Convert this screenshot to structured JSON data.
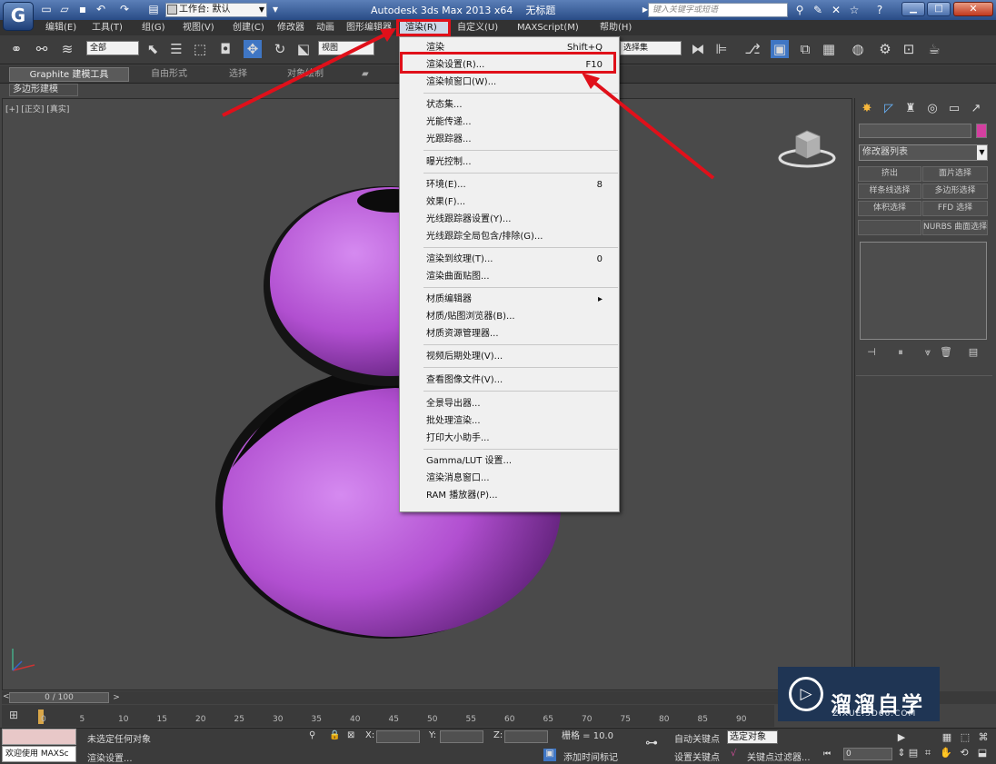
{
  "titlebar": {
    "app_icon": "3ds-max-logo",
    "workspace_label": "工作台: 默认",
    "app_title": "Autodesk 3ds Max  2013 x64",
    "doc_title": "无标题",
    "search_placeholder": "键入关键字或短语"
  },
  "menubar": {
    "items": [
      "编辑(E)",
      "工具(T)",
      "组(G)",
      "视图(V)",
      "创建(C)",
      "修改器",
      "动画",
      "图形编辑器",
      "渲染(R)",
      "自定义(U)",
      "MAXScript(M)",
      "帮助(H)"
    ],
    "active_index": 8
  },
  "toolbar": {
    "selection_filter": "全部",
    "ref_coord": "视图",
    "named_sel": "选择集"
  },
  "ribbon": {
    "tabs": [
      "Graphite 建模工具",
      "自由形式",
      "选择",
      "对象绘制"
    ],
    "sub_label": "多边形建模"
  },
  "viewport": {
    "label": "[+] [正交] [真实]",
    "object_color": "#b14fd0"
  },
  "render_menu": {
    "items": [
      {
        "label": "渲染",
        "shortcut": "Shift+Q"
      },
      {
        "label": "渲染设置(R)...",
        "shortcut": "F10"
      },
      {
        "label": "渲染帧窗口(W)...",
        "shortcut": ""
      },
      {
        "label": "状态集...",
        "shortcut": ""
      },
      {
        "label": "光能传递...",
        "shortcut": ""
      },
      {
        "label": "光跟踪器...",
        "shortcut": ""
      },
      {
        "label": "曝光控制...",
        "shortcut": ""
      },
      {
        "label": "环境(E)...",
        "shortcut": "8"
      },
      {
        "label": "效果(F)...",
        "shortcut": ""
      },
      {
        "label": "光线跟踪器设置(Y)...",
        "shortcut": ""
      },
      {
        "label": "光线跟踪全局包含/排除(G)...",
        "shortcut": ""
      },
      {
        "label": "渲染到纹理(T)...",
        "shortcut": "0"
      },
      {
        "label": "渲染曲面贴图...",
        "shortcut": ""
      },
      {
        "label": "材质编辑器",
        "shortcut": "▸"
      },
      {
        "label": "材质/贴图浏览器(B)...",
        "shortcut": ""
      },
      {
        "label": "材质资源管理器...",
        "shortcut": ""
      },
      {
        "label": "视频后期处理(V)...",
        "shortcut": ""
      },
      {
        "label": "查看图像文件(V)...",
        "shortcut": ""
      },
      {
        "label": "全景导出器...",
        "shortcut": ""
      },
      {
        "label": "批处理渲染...",
        "shortcut": ""
      },
      {
        "label": "打印大小助手...",
        "shortcut": ""
      },
      {
        "label": "Gamma/LUT 设置...",
        "shortcut": ""
      },
      {
        "label": "渲染消息窗口...",
        "shortcut": ""
      },
      {
        "label": "RAM 播放器(P)...",
        "shortcut": ""
      }
    ],
    "highlighted_index": 1
  },
  "command_panel": {
    "modifier_list": "修改器列表",
    "name_color": "#d43fa0",
    "buttons": [
      "挤出",
      "面片选择",
      "样条线选择",
      "多边形选择",
      "体积选择",
      "FFD 选择",
      "",
      "NURBS 曲面选择"
    ]
  },
  "timeline": {
    "frame_display": "0 / 100",
    "ticks": [
      "0",
      "5",
      "10",
      "15",
      "20",
      "25",
      "30",
      "35",
      "40",
      "45",
      "50",
      "55",
      "60",
      "65",
      "70",
      "75",
      "80",
      "85",
      "90"
    ]
  },
  "statusbar": {
    "maxscript_label": "欢迎使用 MAXSc",
    "selection_status": "未选定任何对象",
    "prompt": "渲染设置...",
    "x_label": "X:",
    "y_label": "Y:",
    "z_label": "Z:",
    "grid": "栅格 = 10.0",
    "add_time_tag": "添加时间标记",
    "auto_key": "自动关键点",
    "set_key": "设置关键点",
    "key_mode": "选定对象",
    "key_filters": "关键点过滤器...",
    "frame": "0"
  },
  "watermark": {
    "cn": "溜溜自学",
    "en": "ZIXUE.3D66.COM"
  },
  "annotation_color": "#e0101a"
}
